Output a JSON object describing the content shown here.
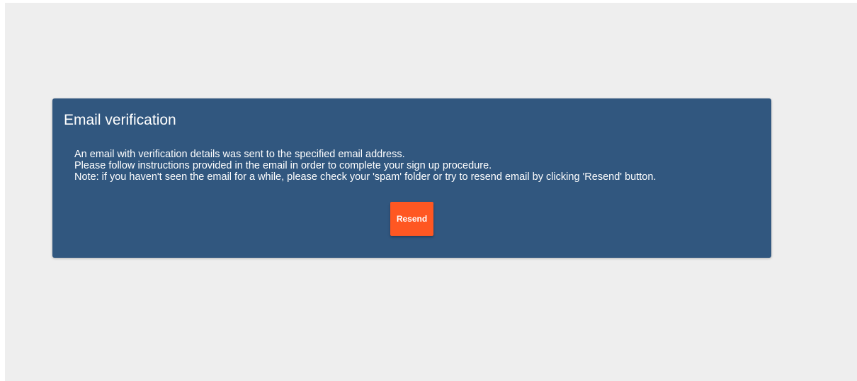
{
  "card": {
    "title": "Email verification",
    "lines": [
      "An email with verification details was sent to the specified email address.",
      "Please follow instructions provided in the email in order to complete your sign up procedure.",
      "Note: if you haven't seen the email for a while, please check your 'spam' folder or try to resend email by clicking 'Resend' button."
    ],
    "resend_label": "Resend"
  },
  "colors": {
    "background": "#eeeeee",
    "card": "#31577f",
    "accent": "#ff5722",
    "text": "#ffffff"
  }
}
